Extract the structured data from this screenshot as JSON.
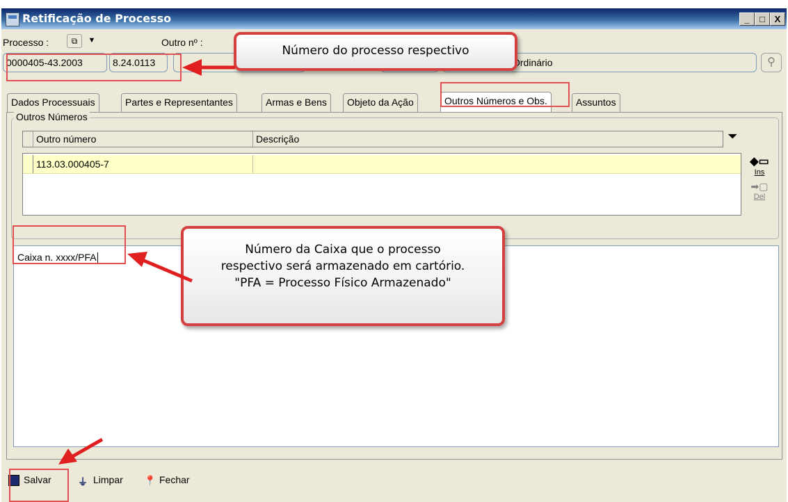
{
  "window": {
    "title": "Retificação de Processo",
    "controls": [
      "_",
      "□",
      "X"
    ]
  },
  "header": {
    "processo_label": "Processo :",
    "outro_label": "Outro nº :",
    "processo_num1": "0000405-43.2003",
    "processo_num2": "8.24.0113",
    "classe_text": "Ordinário"
  },
  "tabs": [
    {
      "label": "Dados Processuais"
    },
    {
      "label": "Partes e Representantes"
    },
    {
      "label": "Armas e Bens"
    },
    {
      "label": "Objeto da Ação"
    },
    {
      "label": "Outros Números e Obs.",
      "active": true
    },
    {
      "label": "Assuntos"
    }
  ],
  "outros_numeros": {
    "group_title": "Outros Números",
    "columns": [
      "Outro número",
      "Descrição"
    ],
    "rows": [
      {
        "outro_numero": "113.03.000405-7",
        "descricao": ""
      }
    ],
    "ins_label": "Ins",
    "del_label": "Del"
  },
  "observacoes": {
    "text": "Caixa n. xxxx/PFA"
  },
  "bottom_buttons": {
    "salvar": "Salvar",
    "limpar": "Limpar",
    "fechar": "Fechar"
  },
  "annotations": {
    "callout1": "Número do processo respectivo",
    "callout2_line1": "Número da Caixa que o processo",
    "callout2_line2": "respectivo será armazenado em cartório.",
    "callout2_line3": "\"PFA = Processo Físico Armazenado\""
  },
  "colors": {
    "titlebar": "#0a246a",
    "highlight_row": "#ffffc8",
    "annotation_red": "#e02020"
  },
  "icons": [
    "app-icon",
    "search-icon",
    "filter-icon",
    "insert-row-icon",
    "delete-row-icon",
    "save-icon",
    "clear-icon",
    "close-pin-icon"
  ]
}
